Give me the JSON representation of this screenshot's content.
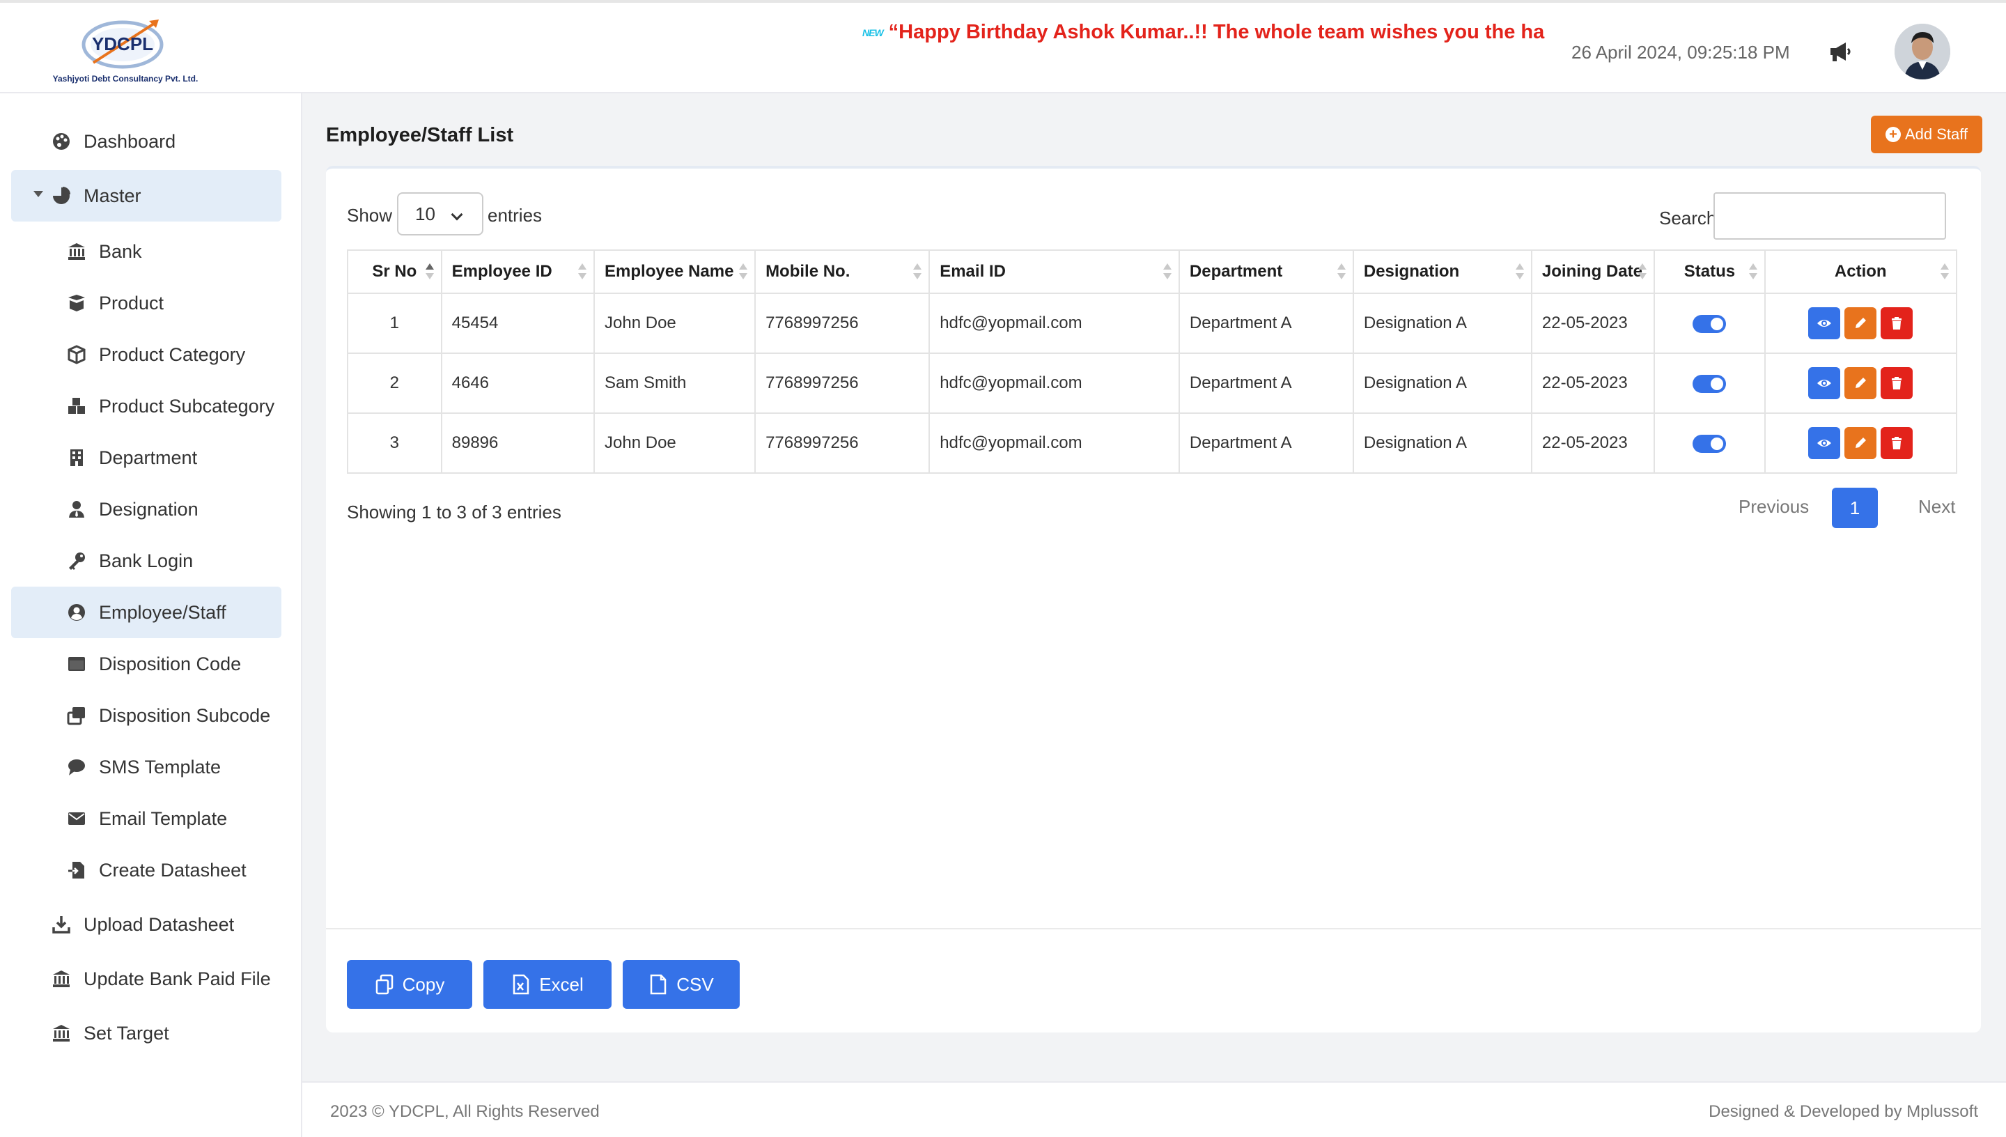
{
  "header": {
    "logo_text": "YDCPL",
    "logo_tagline": "Yashjyoti Debt Consultancy Pvt. Ltd.",
    "ticker_badge": "NEW",
    "ticker_text": "“Happy Birthday Ashok Kumar..!! The whole team wishes you the happiest c",
    "datetime": "26 April 2024, 09:25:18 PM",
    "announce_icon": "megaphone-icon",
    "avatar": "user-avatar"
  },
  "sidebar": {
    "items": [
      {
        "label": "Dashboard",
        "icon": "palette-icon"
      },
      {
        "label": "Master",
        "icon": "pie-chart-icon"
      },
      {
        "label": "Bank",
        "icon": "bank-icon"
      },
      {
        "label": "Product",
        "icon": "box-open-icon"
      },
      {
        "label": "Product Category",
        "icon": "cube-icon"
      },
      {
        "label": "Product Subcategory",
        "icon": "cubes-icon"
      },
      {
        "label": "Department",
        "icon": "building-icon"
      },
      {
        "label": "Designation",
        "icon": "user-tie-icon"
      },
      {
        "label": "Bank Login",
        "icon": "key-icon"
      },
      {
        "label": "Employee/Staff",
        "icon": "user-circle-icon"
      },
      {
        "label": "Disposition Code",
        "icon": "window-icon"
      },
      {
        "label": "Disposition Subcode",
        "icon": "clone-icon"
      },
      {
        "label": "SMS Template",
        "icon": "comment-icon"
      },
      {
        "label": "Email Template",
        "icon": "envelope-icon"
      },
      {
        "label": "Create Datasheet",
        "icon": "file-import-icon"
      },
      {
        "label": "Upload Datasheet",
        "icon": "download-icon"
      },
      {
        "label": "Update Bank Paid File",
        "icon": "bank-icon"
      },
      {
        "label": "Set Target",
        "icon": "bank-icon"
      }
    ],
    "active": "Employee/Staff"
  },
  "main": {
    "title": "Employee/Staff List",
    "add_button": "Add Staff",
    "show_label": "Show",
    "entries_value": "10",
    "entries_label": "entries",
    "search_label": "Search:",
    "search_value": "",
    "columns": [
      "Sr No",
      "Employee ID",
      "Employee Name",
      "Mobile No.",
      "Email ID",
      "Department",
      "Designation",
      "Joining Date",
      "Status",
      "Action"
    ],
    "rows": [
      {
        "sr": "1",
        "emp_id": "45454",
        "name": "John Doe",
        "mobile": "7768997256",
        "email": "hdfc@yopmail.com",
        "dept": "Department A",
        "desig": "Designation A",
        "join": "22-05-2023",
        "status": true
      },
      {
        "sr": "2",
        "emp_id": "4646",
        "name": "Sam Smith",
        "mobile": "7768997256",
        "email": "hdfc@yopmail.com",
        "dept": "Department A",
        "desig": "Designation A",
        "join": "22-05-2023",
        "status": true
      },
      {
        "sr": "3",
        "emp_id": "89896",
        "name": "John Doe",
        "mobile": "7768997256",
        "email": "hdfc@yopmail.com",
        "dept": "Department A",
        "desig": "Designation A",
        "join": "22-05-2023",
        "status": true
      }
    ],
    "info": "Showing 1 to 3 of 3 entries",
    "pagination": {
      "previous": "Previous",
      "current": "1",
      "next": "Next"
    },
    "export_buttons": {
      "copy": "Copy",
      "excel": "Excel",
      "csv": "CSV"
    }
  },
  "footer": {
    "left": "2023 © YDCPL, All Rights Reserved",
    "right": "Designed & Developed by Mplussoft"
  },
  "colors": {
    "primary": "#3572e8",
    "orange": "#e8731d",
    "red": "#e3231b",
    "active_bg": "#e3edf8"
  }
}
